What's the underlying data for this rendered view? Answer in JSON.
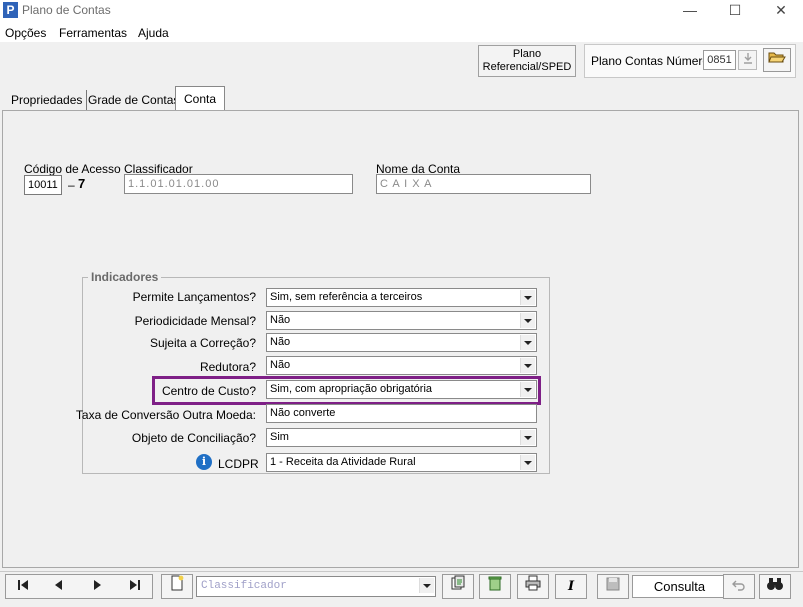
{
  "window": {
    "title": "Plano de Contas",
    "app_icon": "P",
    "minimize": "—",
    "maximize": "☐",
    "close": "✕"
  },
  "menu": [
    "Opções",
    "Ferramentas",
    "Ajuda"
  ],
  "toolbar": {
    "ref_button_line1": "Plano",
    "ref_button_line2": "Referencial/SPED",
    "plano_label": "Plano Contas Número",
    "plano_number": "0851",
    "open_icon": "folder-open-icon"
  },
  "tabs": [
    "Propriedades",
    "Grade de Contas",
    "Conta"
  ],
  "form": {
    "codigo_label": "Código de Acesso",
    "codigo_value": "10011",
    "codigo_dash": "–",
    "codigo_digit": "7",
    "classificador_label": "Classificador",
    "classificador_value": "1.1.01.01.01.00",
    "nome_label": "Nome da Conta",
    "nome_value": "C A I X A"
  },
  "indicadores": {
    "title": "Indicadores",
    "rows": [
      {
        "label": "Permite Lançamentos?",
        "value": "Sim, sem referência a terceiros"
      },
      {
        "label": "Periodicidade Mensal?",
        "value": "Não"
      },
      {
        "label": "Sujeita a Correção?",
        "value": "Não"
      },
      {
        "label": "Redutora?",
        "value": "Não"
      },
      {
        "label": "Centro de Custo?",
        "value": "Sim, com apropriação obrigatória"
      },
      {
        "label": "Taxa de Conversão Outra Moeda:",
        "value": "Não converte"
      },
      {
        "label": "Objeto de Conciliação?",
        "value": "Sim"
      },
      {
        "label": "LCDPR",
        "value": "1 - Receita da Atividade Rural"
      }
    ],
    "highlight_color": "#7e1f86"
  },
  "bottom": {
    "nav": [
      "⏮",
      "◀",
      "▶",
      "⏭"
    ],
    "classificador_placeholder": "Classificador",
    "consulta": "Consulta"
  }
}
